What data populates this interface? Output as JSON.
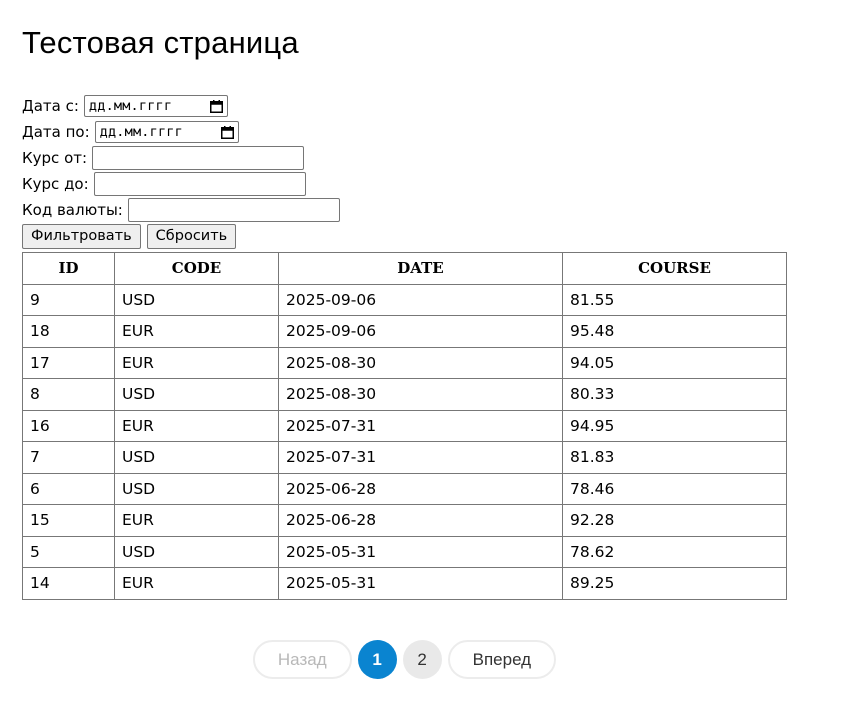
{
  "page": {
    "title": "Тестовая страница"
  },
  "filters": {
    "date_from_label": "Дата с:",
    "date_from_value": "дд.мм.гггг",
    "date_to_label": "Дата по:",
    "date_to_value": "дд.мм.гггг",
    "course_from_label": "Курс от:",
    "course_from_value": "",
    "course_to_label": "Курс до:",
    "course_to_value": "",
    "currency_label": "Код валюты:",
    "currency_value": "",
    "filter_button": "Фильтровать",
    "reset_button": "Сбросить"
  },
  "table": {
    "headers": [
      "ID",
      "CODE",
      "DATE",
      "COURSE"
    ],
    "rows": [
      [
        "9",
        "USD",
        "2025-09-06",
        "81.55"
      ],
      [
        "18",
        "EUR",
        "2025-09-06",
        "95.48"
      ],
      [
        "17",
        "EUR",
        "2025-08-30",
        "94.05"
      ],
      [
        "8",
        "USD",
        "2025-08-30",
        "80.33"
      ],
      [
        "16",
        "EUR",
        "2025-07-31",
        "94.95"
      ],
      [
        "7",
        "USD",
        "2025-07-31",
        "81.83"
      ],
      [
        "6",
        "USD",
        "2025-06-28",
        "78.46"
      ],
      [
        "15",
        "EUR",
        "2025-06-28",
        "92.28"
      ],
      [
        "5",
        "USD",
        "2025-05-31",
        "78.62"
      ],
      [
        "14",
        "EUR",
        "2025-05-31",
        "89.25"
      ]
    ]
  },
  "pagination": {
    "prev_label": "Назад",
    "next_label": "Вперед",
    "pages": [
      "1",
      "2"
    ],
    "current_page": "1"
  },
  "colors": {
    "active_page": "#0a84d0",
    "inactive_page": "#e9e9e9"
  }
}
